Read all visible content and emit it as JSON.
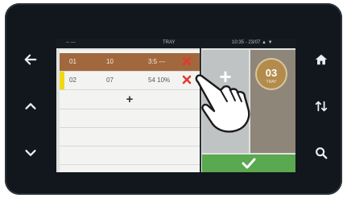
{
  "screen": {
    "title": "TRAY",
    "left_status": "-- ---",
    "right_status": "10:35 - 23/07 ▲ ▼"
  },
  "list": {
    "rows": [
      {
        "index": "01",
        "col2": "10",
        "col3": "3:5 ---"
      },
      {
        "index": "02",
        "col2": "07",
        "col3": "54 10%"
      }
    ],
    "add_label": "+"
  },
  "actions": {
    "add_label": "+"
  },
  "tray_badge": {
    "number": "03",
    "label": "TRAY"
  },
  "side_buttons": {
    "left": [
      "back-arrow-icon",
      "chevron-up-icon",
      "chevron-down-icon"
    ],
    "right": [
      "home-icon",
      "swap-vertical-icon",
      "search-icon"
    ]
  },
  "colors": {
    "selected_row": "#a1683e",
    "highlight_bar": "#f2d814",
    "delete": "#e23a2e",
    "confirm": "#5aa84f",
    "bezel": "#11171c"
  }
}
